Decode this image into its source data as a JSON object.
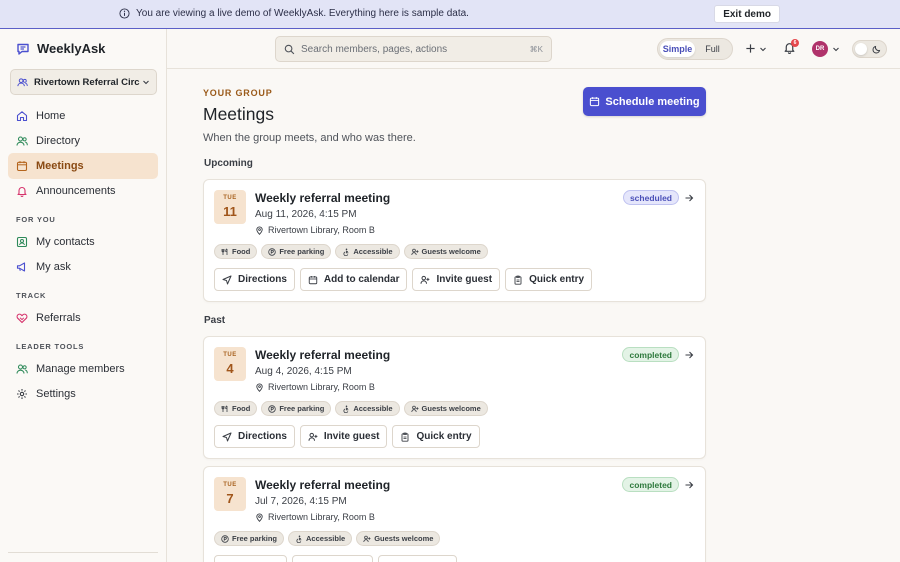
{
  "banner": {
    "message": "You are viewing a live demo of WeeklyAsk. Everything here is sample data.",
    "exit_label": "Exit demo"
  },
  "app": {
    "name": "WeeklyAsk"
  },
  "sidebar": {
    "group_name": "Rivertown Referral Circle",
    "primary": [
      {
        "label": "Home",
        "icon": "home-icon"
      },
      {
        "label": "Directory",
        "icon": "people-icon"
      },
      {
        "label": "Meetings",
        "icon": "calendar-icon",
        "active": true
      },
      {
        "label": "Announcements",
        "icon": "bell-icon"
      }
    ],
    "sections": [
      {
        "title": "FOR YOU",
        "items": [
          {
            "label": "My contacts",
            "icon": "contact-icon"
          },
          {
            "label": "My ask",
            "icon": "megaphone-icon"
          }
        ]
      },
      {
        "title": "TRACK",
        "items": [
          {
            "label": "Referrals",
            "icon": "handshake-icon"
          }
        ]
      },
      {
        "title": "LEADER TOOLS",
        "items": [
          {
            "label": "Manage members",
            "icon": "users-icon"
          },
          {
            "label": "Settings",
            "icon": "gear-icon"
          }
        ]
      }
    ]
  },
  "topbar": {
    "search_placeholder": "Search members, pages, actions",
    "search_shortcut": "⌘K",
    "mode_simple": "Simple",
    "mode_full": "Full",
    "mode_selected": "Simple",
    "notification_count": "6",
    "avatar_initials": "DR"
  },
  "page": {
    "eyebrow": "YOUR GROUP",
    "title": "Meetings",
    "subtitle": "When the group meets, and who was there.",
    "schedule_label": "Schedule meeting",
    "upcoming_label": "Upcoming",
    "past_label": "Past"
  },
  "meetings": [
    {
      "dow": "TUE",
      "day": "11",
      "title": "Weekly referral meeting",
      "datetime": "Aug 11, 2026, 4:15 PM",
      "location": "Rivertown Library, Room B",
      "status": "scheduled",
      "tags": [
        "Food",
        "Free parking",
        "Accessible",
        "Guests welcome"
      ],
      "actions": [
        "Directions",
        "Add to calendar",
        "Invite guest",
        "Quick entry"
      ]
    },
    {
      "dow": "TUE",
      "day": "4",
      "title": "Weekly referral meeting",
      "datetime": "Aug 4, 2026, 4:15 PM",
      "location": "Rivertown Library, Room B",
      "status": "completed",
      "tags": [
        "Food",
        "Free parking",
        "Accessible",
        "Guests welcome"
      ],
      "actions": [
        "Directions",
        "Invite guest",
        "Quick entry"
      ]
    },
    {
      "dow": "TUE",
      "day": "7",
      "title": "Weekly referral meeting",
      "datetime": "Jul 7, 2026, 4:15 PM",
      "location": "Rivertown Library, Room B",
      "status": "completed",
      "tags": [
        "Free parking",
        "Accessible",
        "Guests welcome"
      ],
      "actions": [
        "",
        "",
        ""
      ]
    }
  ],
  "colors": {
    "accent": "#4a4fcf",
    "active_nav_bg": "#f6e3cf",
    "scheduled": "#4a4fb8",
    "completed": "#2e7a3d"
  }
}
